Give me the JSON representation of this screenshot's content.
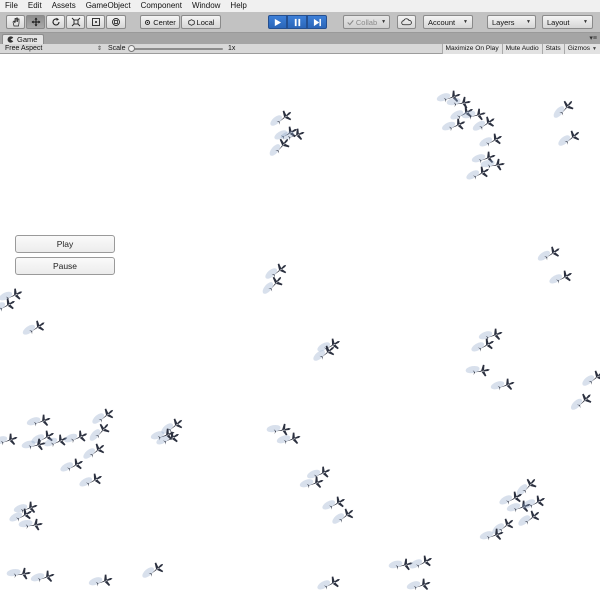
{
  "menu": [
    "File",
    "Edit",
    "Assets",
    "GameObject",
    "Component",
    "Window",
    "Help"
  ],
  "toolbar": {
    "tools": [
      "hand-tool",
      "move-tool",
      "rotate-tool",
      "scale-tool",
      "rect-tool",
      "transform-tool"
    ],
    "pivot_label": "Center",
    "space_label": "Local",
    "collab_label": "Collab",
    "account_label": "Account",
    "layers_label": "Layers",
    "layout_label": "Layout"
  },
  "game_tab": {
    "title": "Game",
    "aspect": "Free Aspect",
    "scale_label": "Scale",
    "scale_value": "1x",
    "options": [
      "Maximize On Play",
      "Mute Audio",
      "Stats",
      "Gizmos"
    ]
  },
  "game_ui": {
    "play_label": "Play",
    "pause_label": "Pause"
  },
  "colors": {
    "toolbar_bg": "#c2c2c2",
    "play_active": "#2b66b8",
    "bird_body": "#2c3140",
    "bird_trail": "#8fa6c8"
  }
}
